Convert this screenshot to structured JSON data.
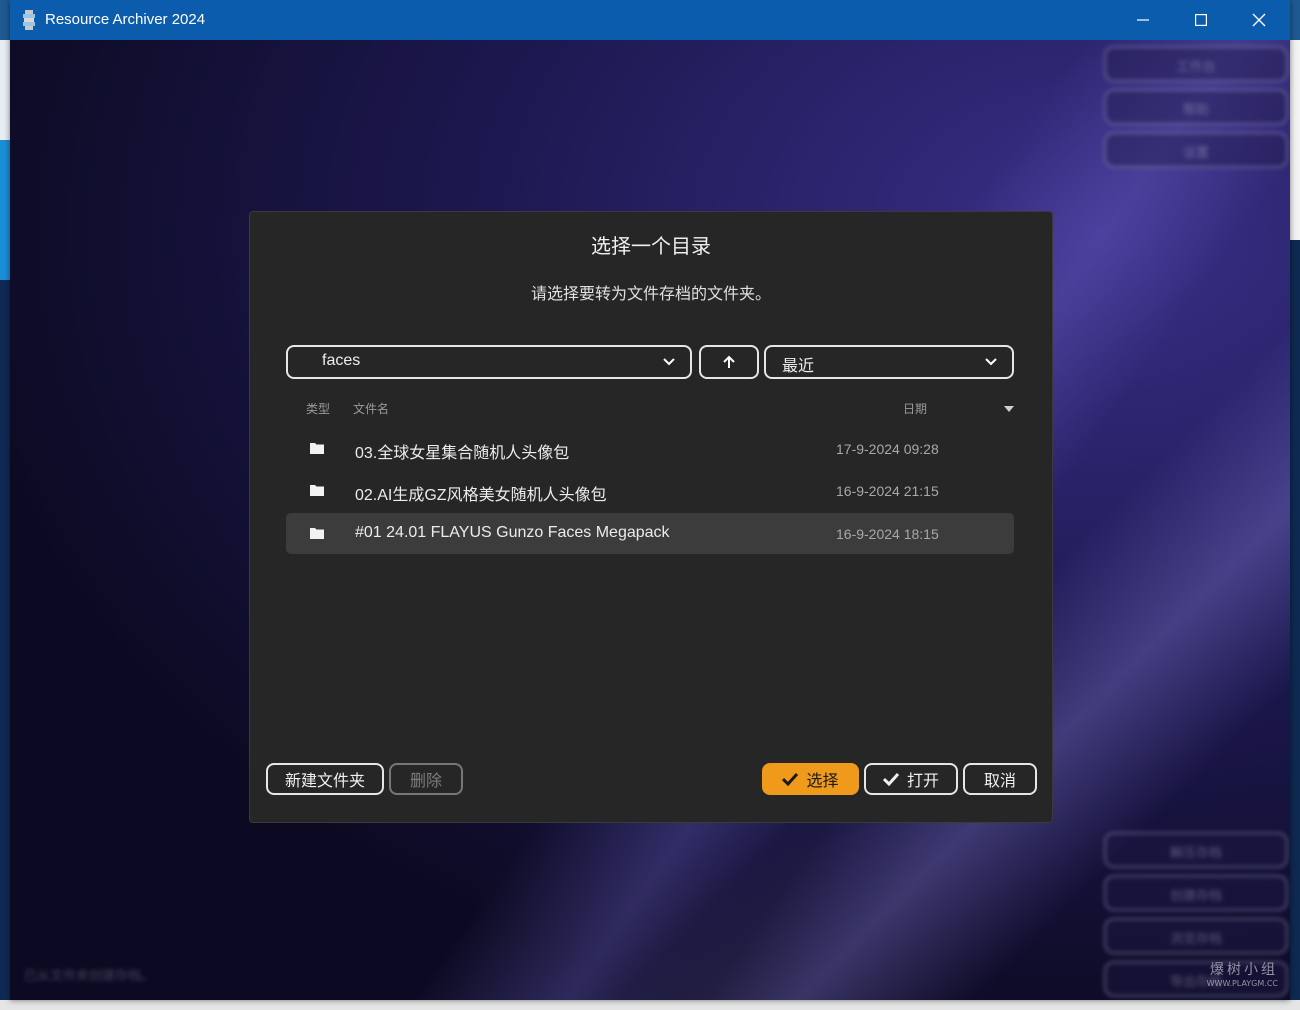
{
  "window": {
    "title": "Resource Archiver 2024"
  },
  "background": {
    "right_buttons": [
      "工作台",
      "帮助",
      "设置",
      "解压存档",
      "创建存档",
      "浏览存档",
      "导出存档"
    ],
    "status": "已从文件夹创建存档。"
  },
  "dialog": {
    "title": "选择一个目录",
    "subtitle": "请选择要转为文件存档的文件夹。",
    "path_value": "faces",
    "sort_value": "最近",
    "columns": {
      "type": "类型",
      "name": "文件名",
      "date": "日期"
    },
    "rows": [
      {
        "name": "03.全球女星集合随机人头像包",
        "date": "17-9-2024 09:28",
        "selected": false
      },
      {
        "name": "02.AI生成GZ风格美女随机人头像包",
        "date": "16-9-2024 21:15",
        "selected": false
      },
      {
        "name": "#01 24.01 FLAYUS Gunzo Faces Megapack",
        "date": "16-9-2024 18:15",
        "selected": true
      }
    ],
    "buttons": {
      "new_folder": "新建文件夹",
      "delete": "删除",
      "select": "选择",
      "open": "打开",
      "cancel": "取消"
    }
  },
  "watermark": {
    "text": "爆树小组",
    "url": "WWW.PLAYGM.CC"
  },
  "colors": {
    "titlebar": "#0b5cad",
    "dialog_bg": "#262626",
    "accent": "#f09a1c",
    "selected_row": "#3c3c3c"
  },
  "icons": [
    "app-icon",
    "minimize-icon",
    "maximize-icon",
    "close-icon",
    "chevron-down-icon",
    "up-arrow-icon",
    "folder-icon",
    "sort-desc-icon",
    "checkmark-icon"
  ]
}
